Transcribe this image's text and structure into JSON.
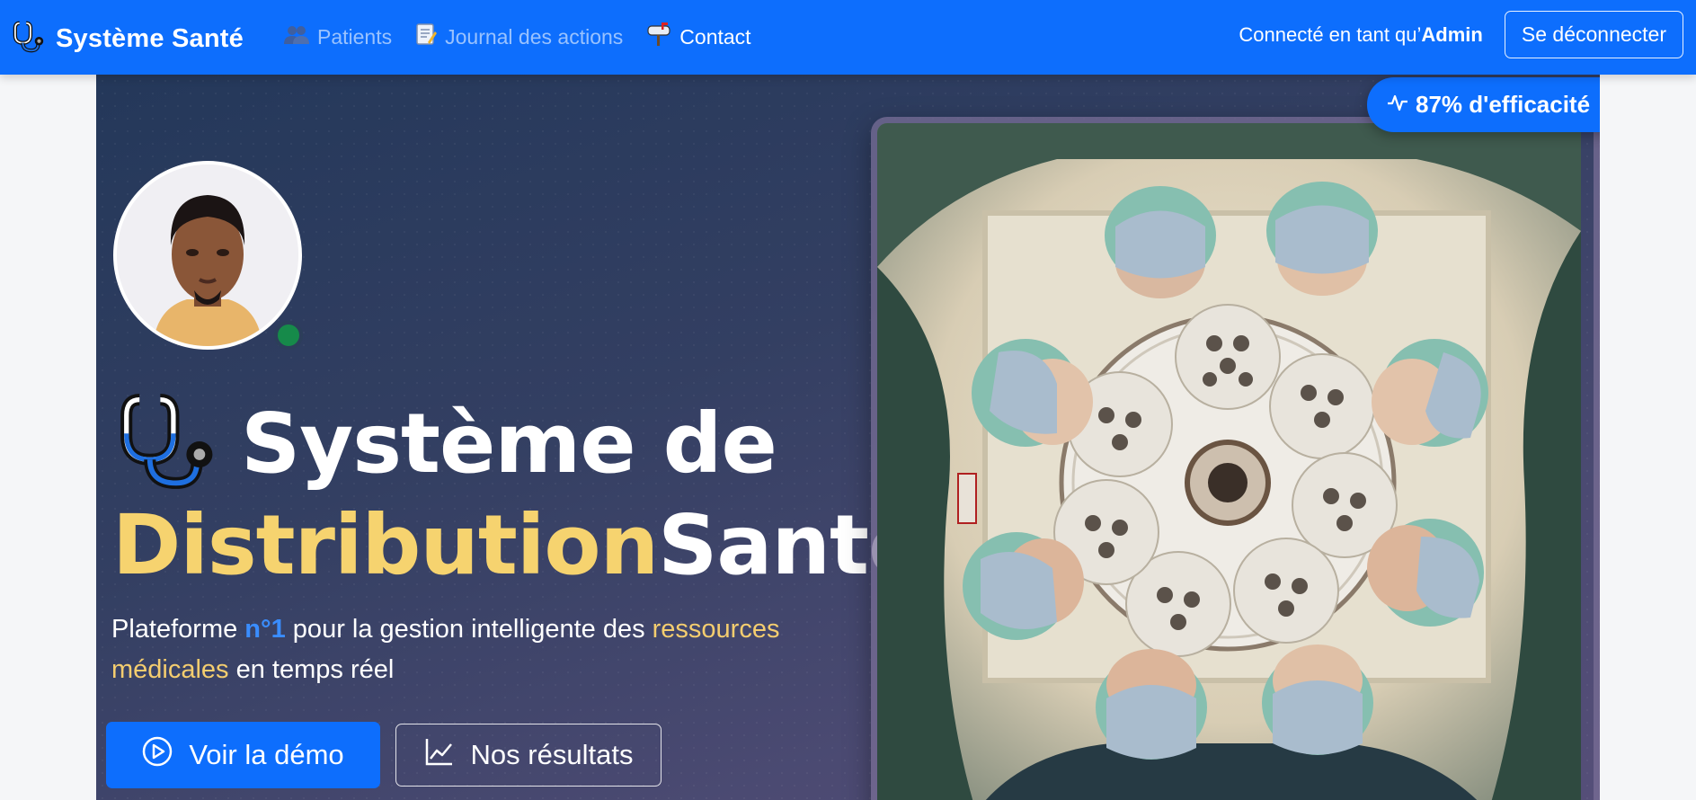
{
  "navbar": {
    "brand": "Système Santé",
    "links": [
      {
        "label": "Patients",
        "icon": "patients-icon"
      },
      {
        "label": "Journal des actions",
        "icon": "journal-icon"
      },
      {
        "label": "Contact",
        "icon": "mailbox-icon"
      }
    ],
    "connected_prefix": "Connecté en tant qu’",
    "connected_user": "Admin",
    "logout_label": "Se déconnecter"
  },
  "hero": {
    "title_line1": "Système de",
    "title_yellow": "Distribution",
    "title_white": "Santé",
    "subtitle_parts": {
      "p1": "Plateforme ",
      "p2": "n°1",
      "p3": " pour la gestion intelligente des ",
      "p4": "ressources médicales",
      "p5": " en temps réel"
    },
    "demo_button": "Voir la démo",
    "results_button": "Nos résultats",
    "efficiency_badge": "87% d'efficacité"
  },
  "colors": {
    "primary": "#0d6efd",
    "accent_yellow": "#f6d36f",
    "status_green": "#168a4a"
  }
}
